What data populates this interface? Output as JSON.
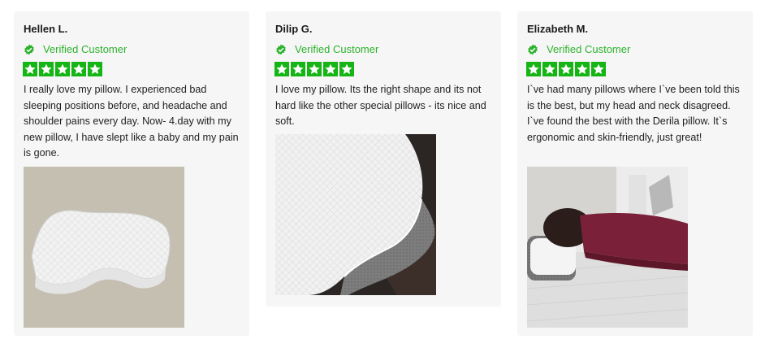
{
  "reviews": [
    {
      "name": "Hellen L.",
      "verified": "Verified Customer",
      "rating": 5,
      "text": "I really love my pillow. I experienced bad sleeping positions before, and headache and shoulder pains every day. Now- 4.day with my new pillow, I have slept like a baby and my pain is gone."
    },
    {
      "name": "Dilip G.",
      "verified": "Verified Customer",
      "rating": 5,
      "text": "I love my pillow. Its the right shape and its not hard like the other special pillows - its nice and soft."
    },
    {
      "name": "Elizabeth M.",
      "verified": "Verified Customer",
      "rating": 5,
      "text": "I`ve had many pillows where I`ve been told this is the best, but my head and neck disagreed. I`ve found the best with the Derila pillow. It`s ergonomic and skin-friendly, just great!"
    }
  ],
  "colors": {
    "card_bg": "#f6f6f6",
    "verified_green": "#2db22d",
    "star_green": "#14b514"
  },
  "icons": {
    "verified": "check-badge-icon",
    "star": "star-icon"
  }
}
